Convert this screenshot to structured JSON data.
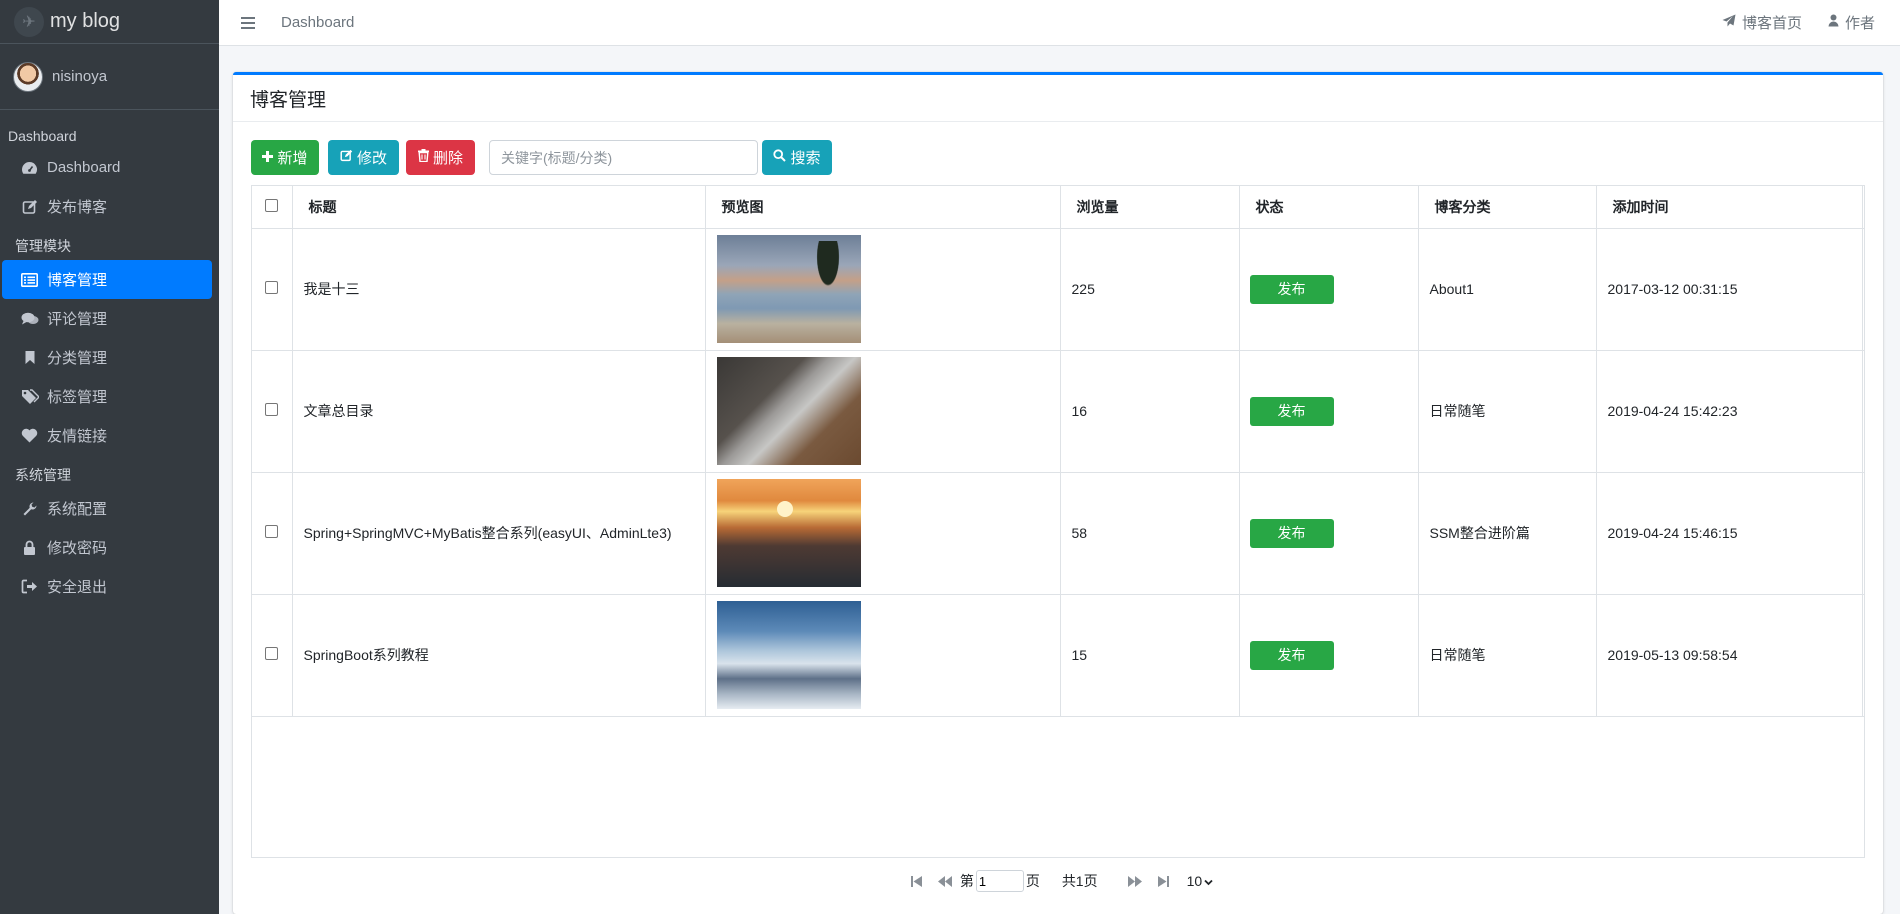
{
  "brand": {
    "title": "my blog"
  },
  "user": {
    "name": "nisinoya"
  },
  "sidebar": {
    "sections": [
      {
        "header": "Dashboard",
        "items": [
          {
            "label": "Dashboard",
            "icon": "dashboard-icon"
          },
          {
            "label": "发布博客",
            "icon": "edit-icon"
          }
        ]
      },
      {
        "header": "管理模块",
        "items": [
          {
            "label": "博客管理",
            "icon": "list-icon",
            "active": true
          },
          {
            "label": "评论管理",
            "icon": "comments-icon"
          },
          {
            "label": "分类管理",
            "icon": "bookmark-icon"
          },
          {
            "label": "标签管理",
            "icon": "tags-icon"
          },
          {
            "label": "友情链接",
            "icon": "heart-icon"
          }
        ]
      },
      {
        "header": "系统管理",
        "items": [
          {
            "label": "系统配置",
            "icon": "wrench-icon"
          },
          {
            "label": "修改密码",
            "icon": "lock-icon"
          },
          {
            "label": "安全退出",
            "icon": "sign-out-icon"
          }
        ]
      }
    ]
  },
  "topbar": {
    "breadcrumb": "Dashboard",
    "links": [
      {
        "label": "博客首页",
        "icon": "paper-plane-icon"
      },
      {
        "label": "作者",
        "icon": "user-icon"
      }
    ]
  },
  "card": {
    "title": "博客管理",
    "toolbar": {
      "add_label": "新增",
      "edit_label": "修改",
      "delete_label": "删除",
      "search_placeholder": "关键字(标题/分类)",
      "search_label": "搜索"
    },
    "table": {
      "columns": [
        "标题",
        "预览图",
        "浏览量",
        "状态",
        "博客分类",
        "添加时间"
      ],
      "rows": [
        {
          "title": "我是十三",
          "image": "beach-palm-photo",
          "views": "225",
          "status": "发布",
          "category": "About1",
          "created": "2017-03-12 00:31:15"
        },
        {
          "title": "文章总目录",
          "image": "laptop-notebook-photo",
          "views": "16",
          "status": "发布",
          "category": "日常随笔",
          "created": "2019-04-24 15:42:23"
        },
        {
          "title": "Spring+SpringMVC+MyBatis整合系列(easyUI、AdminLte3)",
          "image": "ocean-sunset-photo",
          "views": "58",
          "status": "发布",
          "category": "SSM整合进阶篇",
          "created": "2019-04-24 15:46:15"
        },
        {
          "title": "SpringBoot系列教程",
          "image": "snowy-mountain-photo",
          "views": "15",
          "status": "发布",
          "category": "日常随笔",
          "created": "2019-05-13 09:58:54"
        }
      ]
    },
    "pagination": {
      "page_prefix": "第",
      "page_value": "1",
      "page_suffix": "页",
      "total": "共1页",
      "page_size": "10"
    }
  },
  "colors": {
    "sidebar_bg": "#343a40",
    "primary": "#007bff",
    "success": "#28a745",
    "info": "#17a2b8",
    "danger": "#dc3545"
  }
}
